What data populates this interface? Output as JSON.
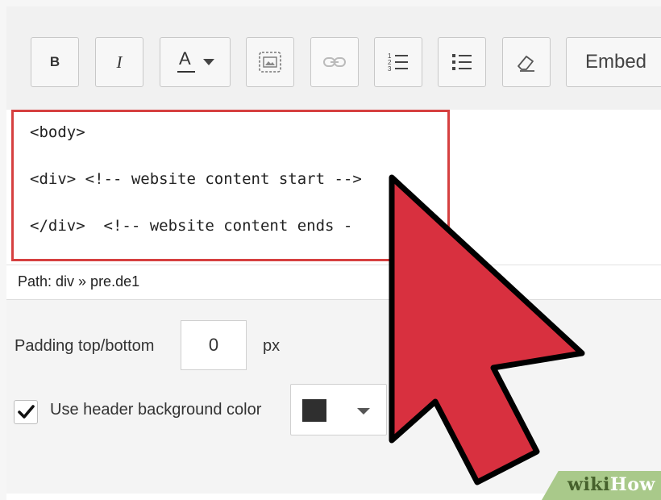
{
  "toolbar": {
    "bold_label": "B",
    "italic_label": "I",
    "text_color_label": "A",
    "embed_label": "Embed",
    "icons": [
      "bold-icon",
      "italic-icon",
      "text-color-icon",
      "image-icon",
      "link-icon",
      "ordered-list-icon",
      "unordered-list-icon",
      "eraser-icon"
    ]
  },
  "editor": {
    "lines": [
      "<body>",
      "<div> <!-- website content start -->",
      "</div>  <!-- website content ends -"
    ],
    "highlight_color": "#d64040"
  },
  "path": {
    "text": "Path: div » pre.de1"
  },
  "settings": {
    "padding_label": "Padding top/bottom",
    "padding_value": "0",
    "padding_unit": "px",
    "header_bg_label": "Use header background color",
    "header_bg_checked": true,
    "header_bg_color": "#2f2f2f"
  },
  "watermark": {
    "wiki": "wiki",
    "how": "How"
  },
  "cursor": {
    "color": "#d8303f",
    "outline": "#000000"
  }
}
